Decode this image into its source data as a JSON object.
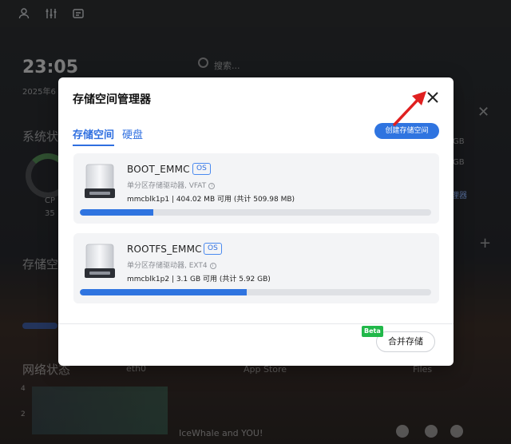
{
  "background": {
    "time": "23:05",
    "date": "2025年6",
    "system_status": "系统状",
    "storage": "存储空",
    "network_status": "网络状态",
    "ethernet": "eth0",
    "app_store": "App Store",
    "files": "Files",
    "search_placeholder": "搜索...",
    "gb1": "GB",
    "gb2": "GB",
    "manager_link": "理器",
    "cpu_label": "CP",
    "cpu_percent": "35",
    "chart_tick_4": "4",
    "chart_tick_2": "2",
    "footer_text": "IceWhale and YOU!"
  },
  "modal": {
    "title": "存储空间管理器",
    "tabs": [
      {
        "label": "存储空间",
        "active": true
      },
      {
        "label": "硬盘",
        "active": false
      }
    ],
    "create_button": "创建存储空间",
    "volumes": [
      {
        "name": "BOOT_EMMC",
        "badge": "OS",
        "type": "单分区存储驱动器, VFAT",
        "usage": "mmcblk1p1 | 404.02 MB 可用 (共计 509.98 MB)",
        "used_fraction": 0.208
      },
      {
        "name": "ROOTFS_EMMC",
        "badge": "OS",
        "type": "单分区存储驱动器, EXT4",
        "usage": "mmcblk1p2 | 3.1 GB 可用 (共计 5.92 GB)",
        "used_fraction": 0.476
      }
    ],
    "merge_button": "合并存储",
    "beta_badge": "Beta"
  },
  "colors": {
    "accent": "#2f74e0",
    "beta": "#21b84a",
    "annotation_arrow": "#e02020"
  }
}
